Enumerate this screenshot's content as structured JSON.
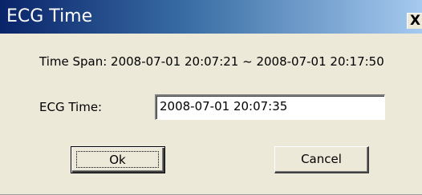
{
  "window": {
    "title": "ECG Time",
    "close_glyph": "X"
  },
  "time_span": {
    "text": "Time Span: 2008-07-01 20:07:21 ~ 2008-07-01 20:17:50"
  },
  "ecg_time": {
    "label": "ECG Time:",
    "value": "2008-07-01 20:07:35"
  },
  "buttons": {
    "ok_label": "Ok",
    "cancel_label": "Cancel"
  }
}
